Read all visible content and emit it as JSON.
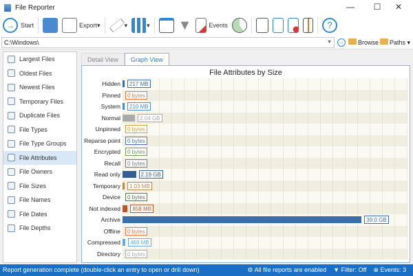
{
  "window": {
    "title": "File Reporter",
    "minimize": "—",
    "maximize": "☐",
    "close": "✕"
  },
  "toolbar": {
    "start": "Start",
    "export": "Export",
    "events": "Events"
  },
  "pathbar": {
    "path": "C:\\Windows\\",
    "browse": "Browse",
    "paths": "Paths"
  },
  "sidebar": {
    "items": [
      "Largest Files",
      "Oldest Files",
      "Newest Files",
      "Temporary Files",
      "Duplicate Files",
      "File Types",
      "File Type Groups",
      "File Attributes",
      "File Owners",
      "File Sizes",
      "File Names",
      "File Dates",
      "File Depths"
    ],
    "selected": "File Attributes"
  },
  "tabs": [
    "Detail View",
    "Graph View"
  ],
  "chart_data": {
    "type": "bar",
    "orientation": "horizontal",
    "title": "File Attributes by Size",
    "unit": "GB",
    "categories": [
      "Hidden",
      "Pinned",
      "System",
      "Normal",
      "Unpinned",
      "Reparse point",
      "Encrypted",
      "Recall",
      "Read only",
      "Temporary",
      "Device",
      "Not indexed",
      "Archive",
      "Offline",
      "Compressed",
      "Directory"
    ],
    "values": [
      0.212,
      0,
      0.205,
      2.04,
      0,
      0,
      0,
      0,
      2.19,
      0.001,
      0,
      0.838,
      39.0,
      0,
      0.458,
      0
    ],
    "labels": [
      "217 MB",
      "0 bytes",
      "210 MB",
      "2.04 GB",
      "0 bytes",
      "0 bytes",
      "0 bytes",
      "0 bytes",
      "2.19 GB",
      "1.03 MB",
      "0 bytes",
      "858 MB",
      "39.0 GB",
      "0 bytes",
      "469 MB",
      "0 bytes"
    ],
    "colors": [
      "#3a6ea8",
      "#e07a40",
      "#4a8ad0",
      "#aaaaaa",
      "#d0a040",
      "#4a70b0",
      "#6a9a50",
      "#777777",
      "#335f95",
      "#c08a40",
      "#557755",
      "#b8582a",
      "#3a6ea8",
      "#e07a40",
      "#6aa8e0",
      "#aaaaaa"
    ],
    "xlim": [
      0,
      42
    ]
  },
  "status": {
    "message": "Report generation complete (double-click an entry to open or drill down)",
    "reports": "All file reports are enabled",
    "filter": "Filter: Off",
    "events": "Events: 3"
  }
}
